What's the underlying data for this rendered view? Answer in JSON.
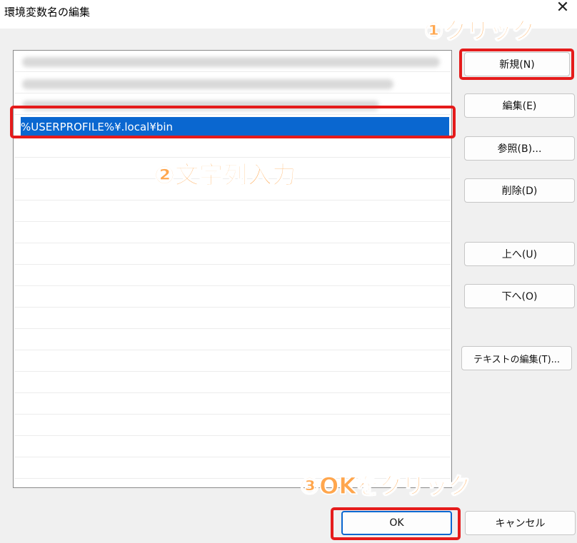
{
  "window": {
    "title": "環境変数名の編集",
    "close_glyph": "✕"
  },
  "list": {
    "selected_value": "%USERPROFILE%¥.local¥bin",
    "blurred_entries": 3
  },
  "buttons": {
    "new": "新規(N)",
    "edit": "編集(E)",
    "browse": "参照(B)...",
    "delete": "削除(D)",
    "move_up": "上へ(U)",
    "move_down": "下へ(O)",
    "edit_text": "テキストの編集(T)...",
    "ok": "OK",
    "cancel": "キャンセル"
  },
  "annotations": {
    "step1": "①クリック",
    "step2": "②文字列入力",
    "step3": "③OKをクリック",
    "callout_color": "#ffa64d",
    "highlight_color": "#e51b1b"
  },
  "colors": {
    "selection": "#0a67d0",
    "dialog_bg": "#f0f0f0"
  }
}
